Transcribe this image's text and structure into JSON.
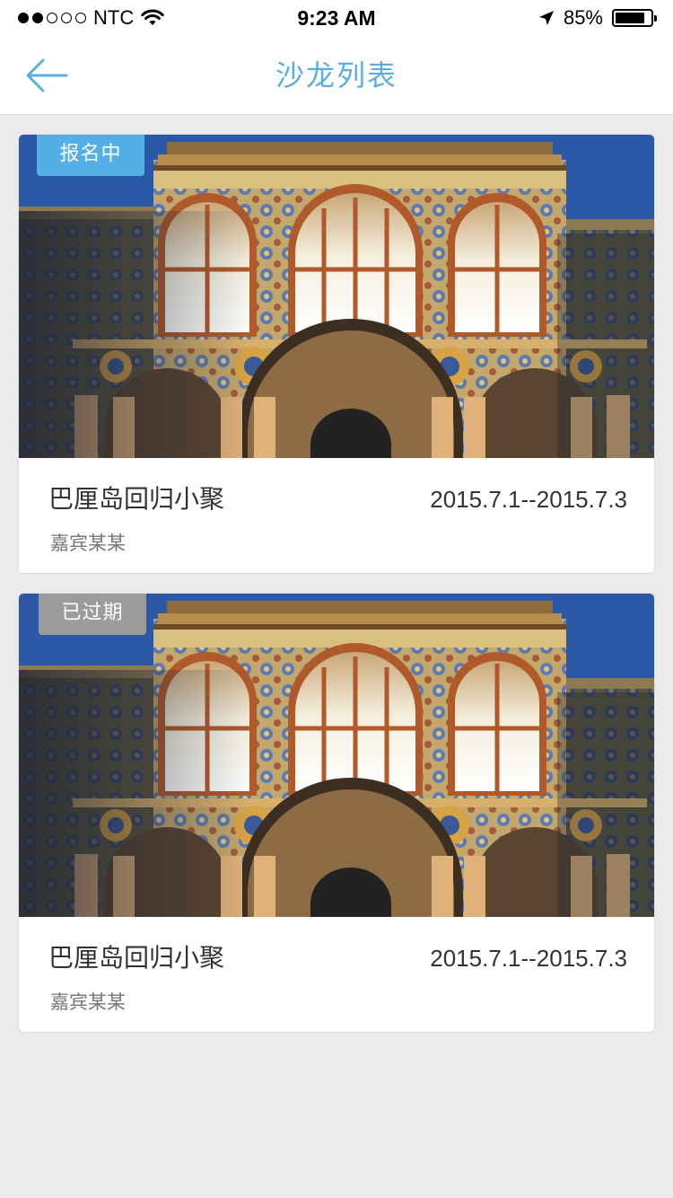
{
  "status_bar": {
    "signal_dots": [
      "full",
      "full",
      "empty",
      "empty",
      "empty"
    ],
    "carrier": "NTC",
    "time": "9:23 AM",
    "battery_percent": "85%",
    "battery_level": 0.85,
    "icons": [
      "wifi-icon",
      "location-arrow-icon",
      "battery-icon"
    ]
  },
  "navbar": {
    "title": "沙龙列表",
    "back_icon": "arrow-left-icon",
    "accent_color": "#5aaee3"
  },
  "salons": [
    {
      "status": "报名中",
      "status_type": "active",
      "status_color": "#55aee6",
      "title": "巴厘岛回归小聚",
      "date": "2015.7.1--2015.7.3",
      "guest": "嘉宾某某"
    },
    {
      "status": "已过期",
      "status_type": "expired",
      "status_color": "#9c9c9c",
      "title": "巴厘岛回归小聚",
      "date": "2015.7.1--2015.7.3",
      "guest": "嘉宾某某"
    }
  ]
}
